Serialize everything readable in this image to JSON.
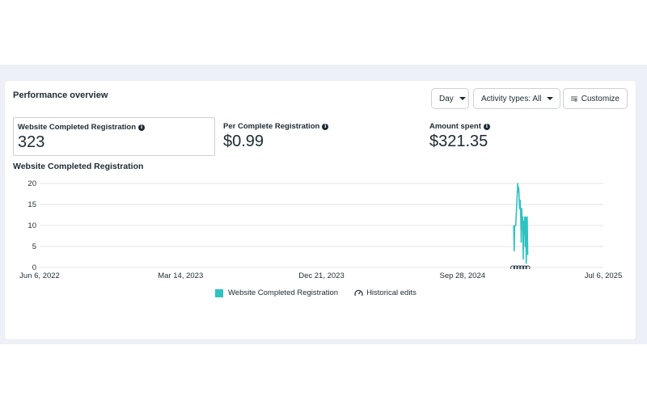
{
  "panel": {
    "title": "Performance overview"
  },
  "controls": {
    "day_label": "Day",
    "activity_label": "Activity types: All",
    "customize_label": "Customize"
  },
  "metrics": [
    {
      "label": "Website Completed Registration",
      "value": "323"
    },
    {
      "label": "Per Complete Registration",
      "value": "$0.99"
    },
    {
      "label": "Amount spent",
      "value": "$321.35"
    }
  ],
  "chart_section": {
    "title": "Website Completed Registration"
  },
  "legend": {
    "series_label": "Website Completed Registration",
    "edits_label": "Historical edits"
  },
  "colors": {
    "series": "#2fc2c2",
    "grid": "#e4e6eb",
    "text": "#1c2b33"
  },
  "chart_data": {
    "type": "line",
    "title": "Website Completed Registration",
    "xlabel": "",
    "ylabel": "",
    "ylim": [
      0,
      20
    ],
    "yticks": [
      0,
      5,
      10,
      15,
      20
    ],
    "xticks": [
      "Jun 6, 2022",
      "Mar 14, 2023",
      "Dec 21, 2023",
      "Sep 28, 2024",
      "Jul 6, 2025"
    ],
    "xlim": [
      "2022-06-06",
      "2025-07-06"
    ],
    "grid": true,
    "series": [
      {
        "name": "Website Completed Registration",
        "points": [
          [
            "2025-01-08",
            10
          ],
          [
            "2025-01-09",
            4
          ],
          [
            "2025-01-10",
            10
          ],
          [
            "2025-01-12",
            10
          ],
          [
            "2025-01-16",
            20
          ],
          [
            "2025-01-17",
            18
          ],
          [
            "2025-01-18",
            19
          ],
          [
            "2025-01-19",
            16
          ],
          [
            "2025-01-20",
            14
          ],
          [
            "2025-01-21",
            16
          ],
          [
            "2025-01-22",
            12
          ],
          [
            "2025-01-23",
            6
          ],
          [
            "2025-01-24",
            14
          ],
          [
            "2025-01-25",
            9
          ],
          [
            "2025-01-26",
            12
          ],
          [
            "2025-01-27",
            2
          ],
          [
            "2025-01-28",
            11
          ],
          [
            "2025-01-29",
            8
          ],
          [
            "2025-01-30",
            12
          ],
          [
            "2025-01-31",
            5
          ],
          [
            "2025-02-01",
            12
          ],
          [
            "2025-02-02",
            1
          ],
          [
            "2025-02-03",
            7
          ],
          [
            "2025-02-04",
            12
          ],
          [
            "2025-02-05",
            3
          ]
        ]
      }
    ],
    "historical_edit_dates": [
      "2025-01-06",
      "2025-01-12",
      "2025-01-18",
      "2025-01-24",
      "2025-01-30",
      "2025-02-05"
    ]
  }
}
